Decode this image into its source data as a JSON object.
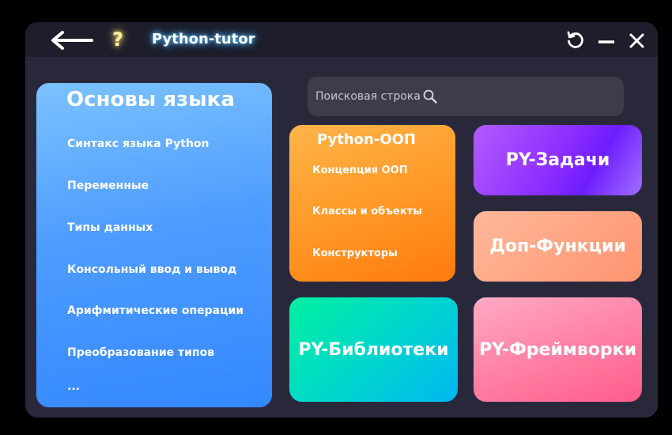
{
  "titlebar": {
    "title": "Python-tutor",
    "help_label": "?",
    "icons": {
      "back": "arrow-left-icon",
      "reload": "reload-icon",
      "minimize": "minimize-icon",
      "close": "close-icon"
    }
  },
  "basics": {
    "title": "Основы языка",
    "topics": [
      "Синтакс языка Python",
      "Переменные",
      "Типы данных",
      "Консольный ввод и вывод",
      "Арифмитические операции",
      "Преобразование типов",
      "..."
    ]
  },
  "search": {
    "placeholder": "Поисковая строка",
    "icon": "search-icon"
  },
  "oop": {
    "title": "Python-ООП",
    "items": [
      "Концепция ООП",
      "Классы и объекты",
      "Конструкторы"
    ]
  },
  "cards": {
    "tasks": "PY-Задачи",
    "extra": "Доп-Функции",
    "libraries": "PY-Библиотеки",
    "frameworks": "PY-Фреймворки"
  },
  "colors": {
    "window_bg": "#28283a",
    "titlebar_bg": "#1d1d2b",
    "basics_card": "#4d9cff",
    "oop_card": "#ff9a28",
    "tasks_card": "#8c2dff",
    "extra_card": "#ffa584",
    "libraries_card": "#00d4d0",
    "frameworks_card": "#ff7aa0"
  }
}
